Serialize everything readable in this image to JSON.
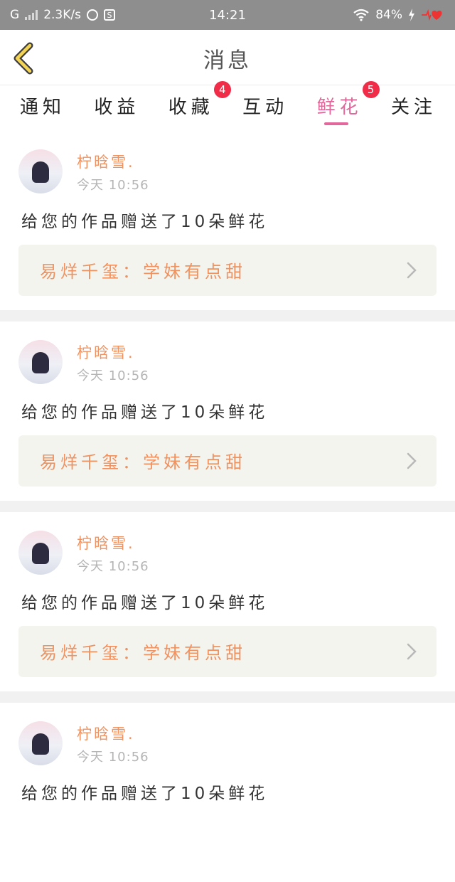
{
  "status_bar": {
    "network": "G",
    "speed": "2.3K/s",
    "time": "14:21",
    "battery": "84%"
  },
  "header": {
    "title": "消息"
  },
  "tabs": [
    {
      "label": "通知",
      "badge": null,
      "active": false
    },
    {
      "label": "收益",
      "badge": null,
      "active": false
    },
    {
      "label": "收藏",
      "badge": "4",
      "active": false
    },
    {
      "label": "互动",
      "badge": null,
      "active": false
    },
    {
      "label": "鲜花",
      "badge": "5",
      "active": true
    },
    {
      "label": "关注",
      "badge": null,
      "active": false
    }
  ],
  "messages": [
    {
      "user": "柠晗雪.",
      "time": "今天 10:56",
      "text": "给您的作品赠送了10朵鲜花",
      "work": "易烊千玺：学妹有点甜"
    },
    {
      "user": "柠晗雪.",
      "time": "今天 10:56",
      "text": "给您的作品赠送了10朵鲜花",
      "work": "易烊千玺：学妹有点甜"
    },
    {
      "user": "柠晗雪.",
      "time": "今天 10:56",
      "text": "给您的作品赠送了10朵鲜花",
      "work": "易烊千玺：学妹有点甜"
    },
    {
      "user": "柠晗雪.",
      "time": "今天 10:56",
      "text": "给您的作品赠送了10朵鲜花",
      "work": null
    }
  ],
  "colors": {
    "accent": "#e2679a",
    "badge": "#f02c49",
    "username": "#f0925f",
    "status_bar": "#8e8e8e"
  },
  "icons": [
    "back-arrow-icon",
    "chevron-right-icon",
    "wifi-icon",
    "battery-icon",
    "heart-rate-icon",
    "signal-icon"
  ]
}
